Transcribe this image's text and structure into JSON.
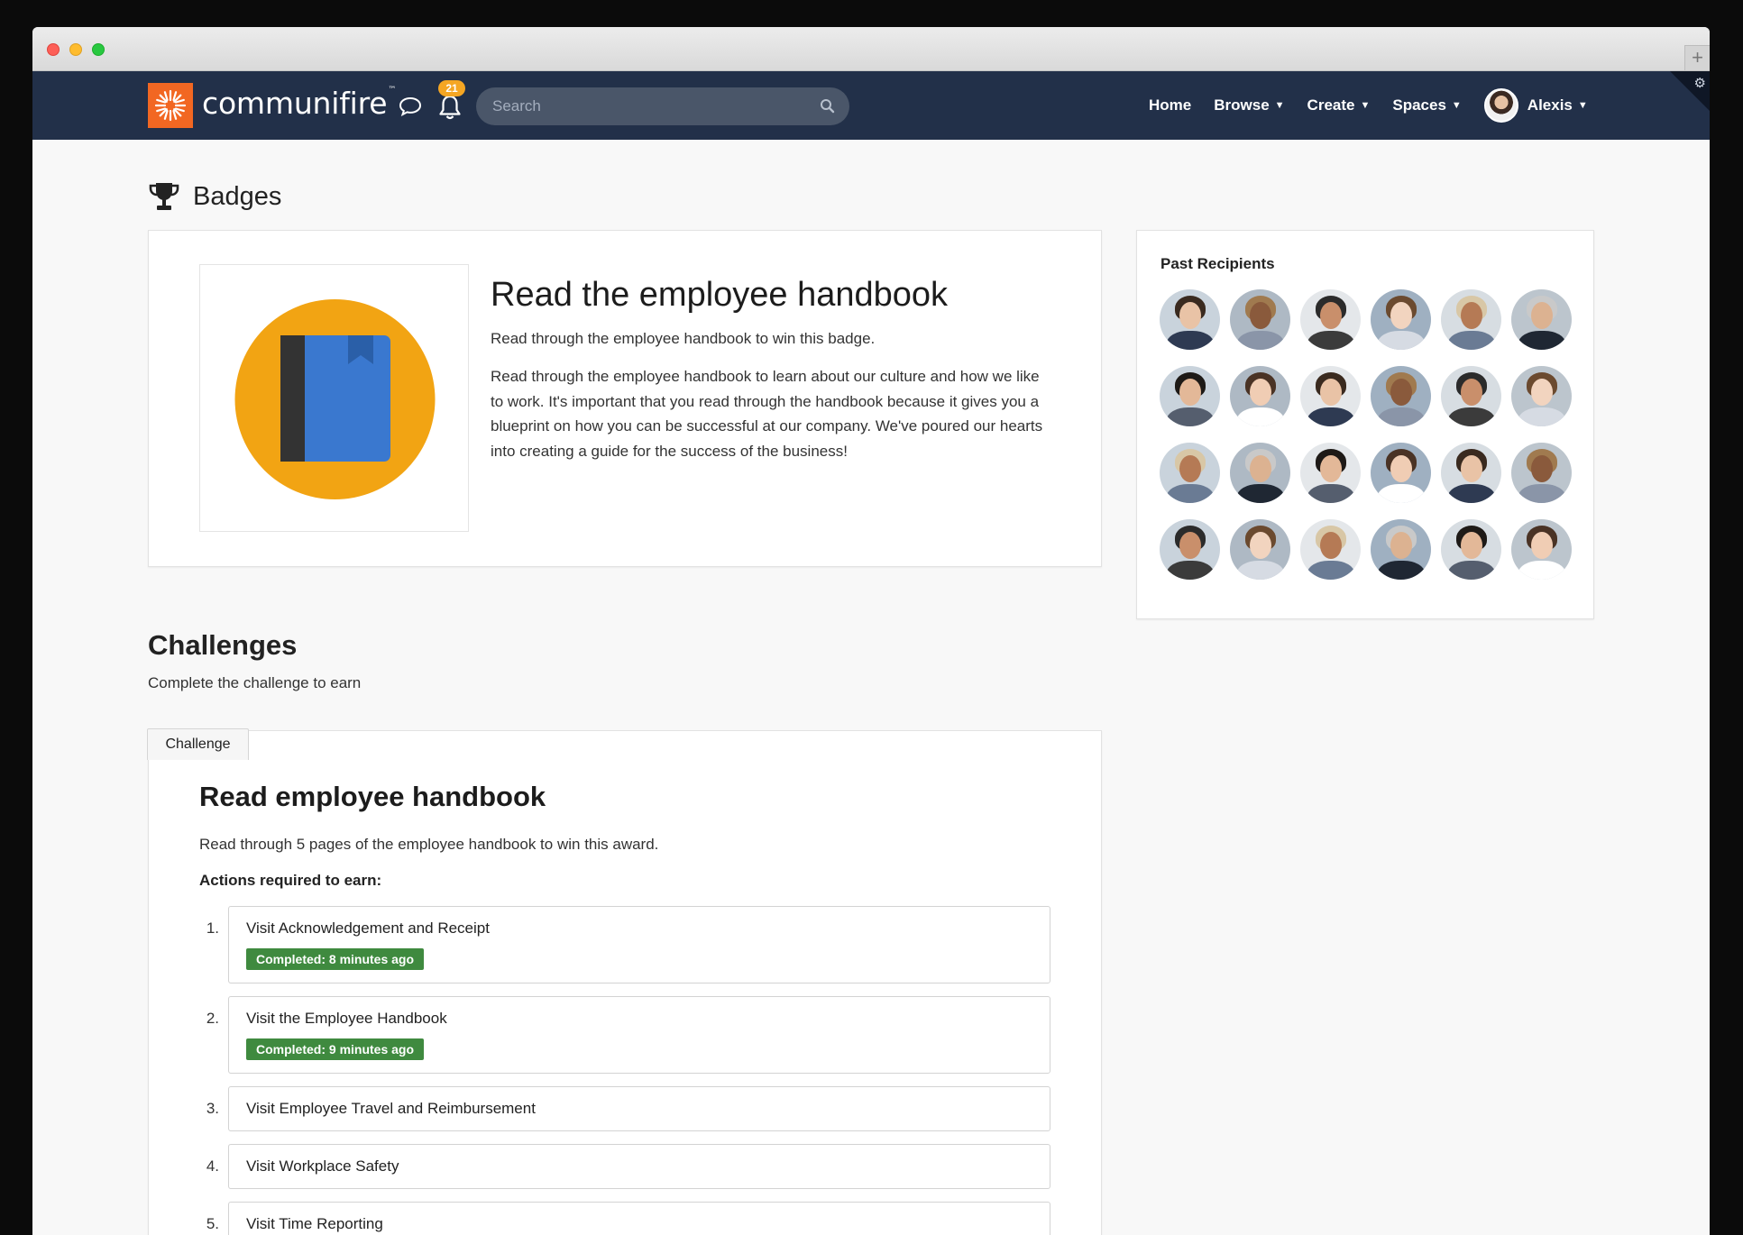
{
  "app": {
    "logo_text": "communifire",
    "logo_tm": "™",
    "brand_color": "#f26722",
    "nav_color": "#223049"
  },
  "header": {
    "notification_count": "21",
    "search_placeholder": "Search",
    "nav": [
      {
        "label": "Home",
        "has_caret": false
      },
      {
        "label": "Browse",
        "has_caret": true
      },
      {
        "label": "Create",
        "has_caret": true
      },
      {
        "label": "Spaces",
        "has_caret": true
      }
    ],
    "user_name": "Alexis"
  },
  "page": {
    "title": "Badges"
  },
  "badge": {
    "title": "Read the employee handbook",
    "subtitle": "Read through the employee handbook to win this badge.",
    "description": "Read through the employee handbook to learn about our culture and how we like to work. It's important that you read through the handbook because it gives you a blueprint on how you can be successful at our company. We've poured our hearts into creating a guide for the success of the business!",
    "icon": "book-icon",
    "icon_colors": {
      "circle": "#f2a413",
      "book": "#3a78cf",
      "spine": "#333333"
    }
  },
  "recipients": {
    "title": "Past Recipients",
    "count": 24
  },
  "challenges": {
    "heading": "Challenges",
    "subtitle": "Complete the challenge to earn",
    "tab_label": "Challenge",
    "title": "Read employee handbook",
    "description": "Read through 5 pages of the employee handbook to win this award.",
    "actions_label": "Actions required to earn:",
    "steps": [
      {
        "num": "1.",
        "label": "Visit Acknowledgement and Receipt",
        "status": "Completed: 8 minutes ago"
      },
      {
        "num": "2.",
        "label": "Visit the Employee Handbook",
        "status": "Completed: 9 minutes ago"
      },
      {
        "num": "3.",
        "label": "Visit Employee Travel and Reimbursement",
        "status": ""
      },
      {
        "num": "4.",
        "label": "Visit Workplace Safety",
        "status": ""
      },
      {
        "num": "5.",
        "label": "Visit Time Reporting",
        "status": ""
      }
    ],
    "completed_color": "#3f8a3f"
  }
}
